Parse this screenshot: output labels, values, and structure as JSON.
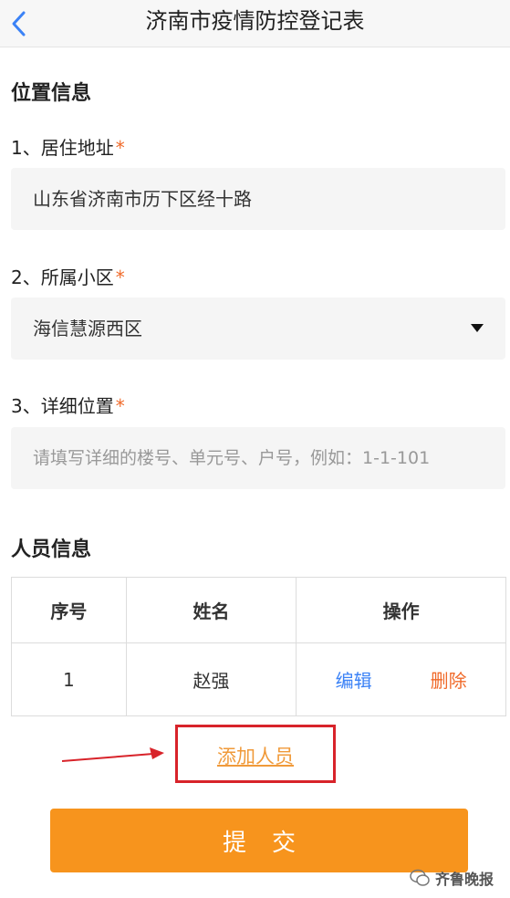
{
  "header": {
    "title": "济南市疫情防控登记表"
  },
  "location_section": {
    "title": "位置信息"
  },
  "fields": {
    "address": {
      "label": "1、居住地址",
      "required": "*",
      "value": "山东省济南市历下区经十路"
    },
    "community": {
      "label": "2、所属小区",
      "required": "*",
      "value": "海信慧源西区"
    },
    "detail": {
      "label": "3、详细位置",
      "required": "*",
      "placeholder": "请填写详细的楼号、单元号、户号，例如：1-1-101"
    }
  },
  "people_section": {
    "title": "人员信息",
    "columns": [
      "序号",
      "姓名",
      "操作"
    ],
    "rows": [
      {
        "index": "1",
        "name": "赵强",
        "edit": "编辑",
        "delete": "删除"
      }
    ]
  },
  "add_person_label": "添加人员",
  "submit_label": "提交",
  "watermark": "齐鲁晚报",
  "colors": {
    "accent": "#f7941d",
    "required": "#f06a2a",
    "edit": "#3b82f6",
    "highlight": "#d8232a"
  }
}
